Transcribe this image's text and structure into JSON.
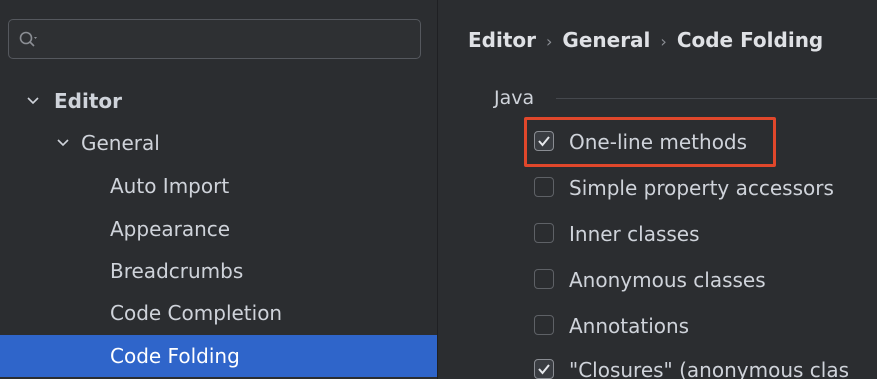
{
  "search": {
    "value": "",
    "placeholder": ""
  },
  "sidebar": {
    "items": [
      {
        "label": "Editor"
      },
      {
        "label": "General"
      },
      {
        "label": "Auto Import"
      },
      {
        "label": "Appearance"
      },
      {
        "label": "Breadcrumbs"
      },
      {
        "label": "Code Completion"
      },
      {
        "label": "Code Folding"
      }
    ]
  },
  "breadcrumb": [
    "Editor",
    "General",
    "Code Folding"
  ],
  "breadcrumb_separator": "›",
  "section": {
    "title": "Java"
  },
  "options": [
    {
      "label": "One-line methods",
      "checked": true
    },
    {
      "label": "Simple property accessors",
      "checked": false
    },
    {
      "label": "Inner classes",
      "checked": false
    },
    {
      "label": "Anonymous classes",
      "checked": false
    },
    {
      "label": "Annotations",
      "checked": false
    },
    {
      "label": "\"Closures\" (anonymous clas",
      "checked": true
    }
  ],
  "colors": {
    "selection": "#2f65ca",
    "highlight_box": "#e0472b",
    "background": "#2b2d30"
  }
}
